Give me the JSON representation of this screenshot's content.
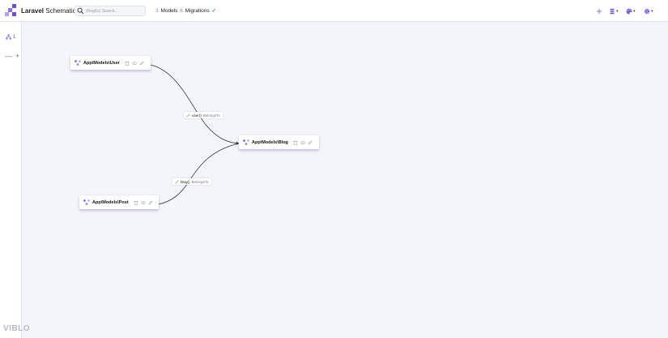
{
  "header": {
    "brand_bold": "Laravel",
    "brand_rest": "Schematics",
    "search_placeholder": "(RegEx) Search...",
    "models_count": "3",
    "models_label": "Models",
    "migrations_count": "6",
    "migrations_label": "Migrations",
    "migrations_status": "✓"
  },
  "sidebar": {
    "level_count": "1",
    "zoom_out": "—",
    "zoom_in": "+"
  },
  "nodes": [
    {
      "name": "App\\Models\\User"
    },
    {
      "name": "App\\Models\\Blog"
    },
    {
      "name": "App\\Models\\Post"
    }
  ],
  "edges": [
    {
      "method": "user()",
      "relation": "BelongsTo"
    },
    {
      "method": "blog()",
      "relation": "BelongsTo"
    }
  ],
  "footer": {
    "mark": "VIBLO"
  },
  "colors": {
    "accent": "#8c7ad6",
    "logo": "#6d4fd8",
    "success": "#2aa84a",
    "canvas": "#f4f5fa"
  }
}
